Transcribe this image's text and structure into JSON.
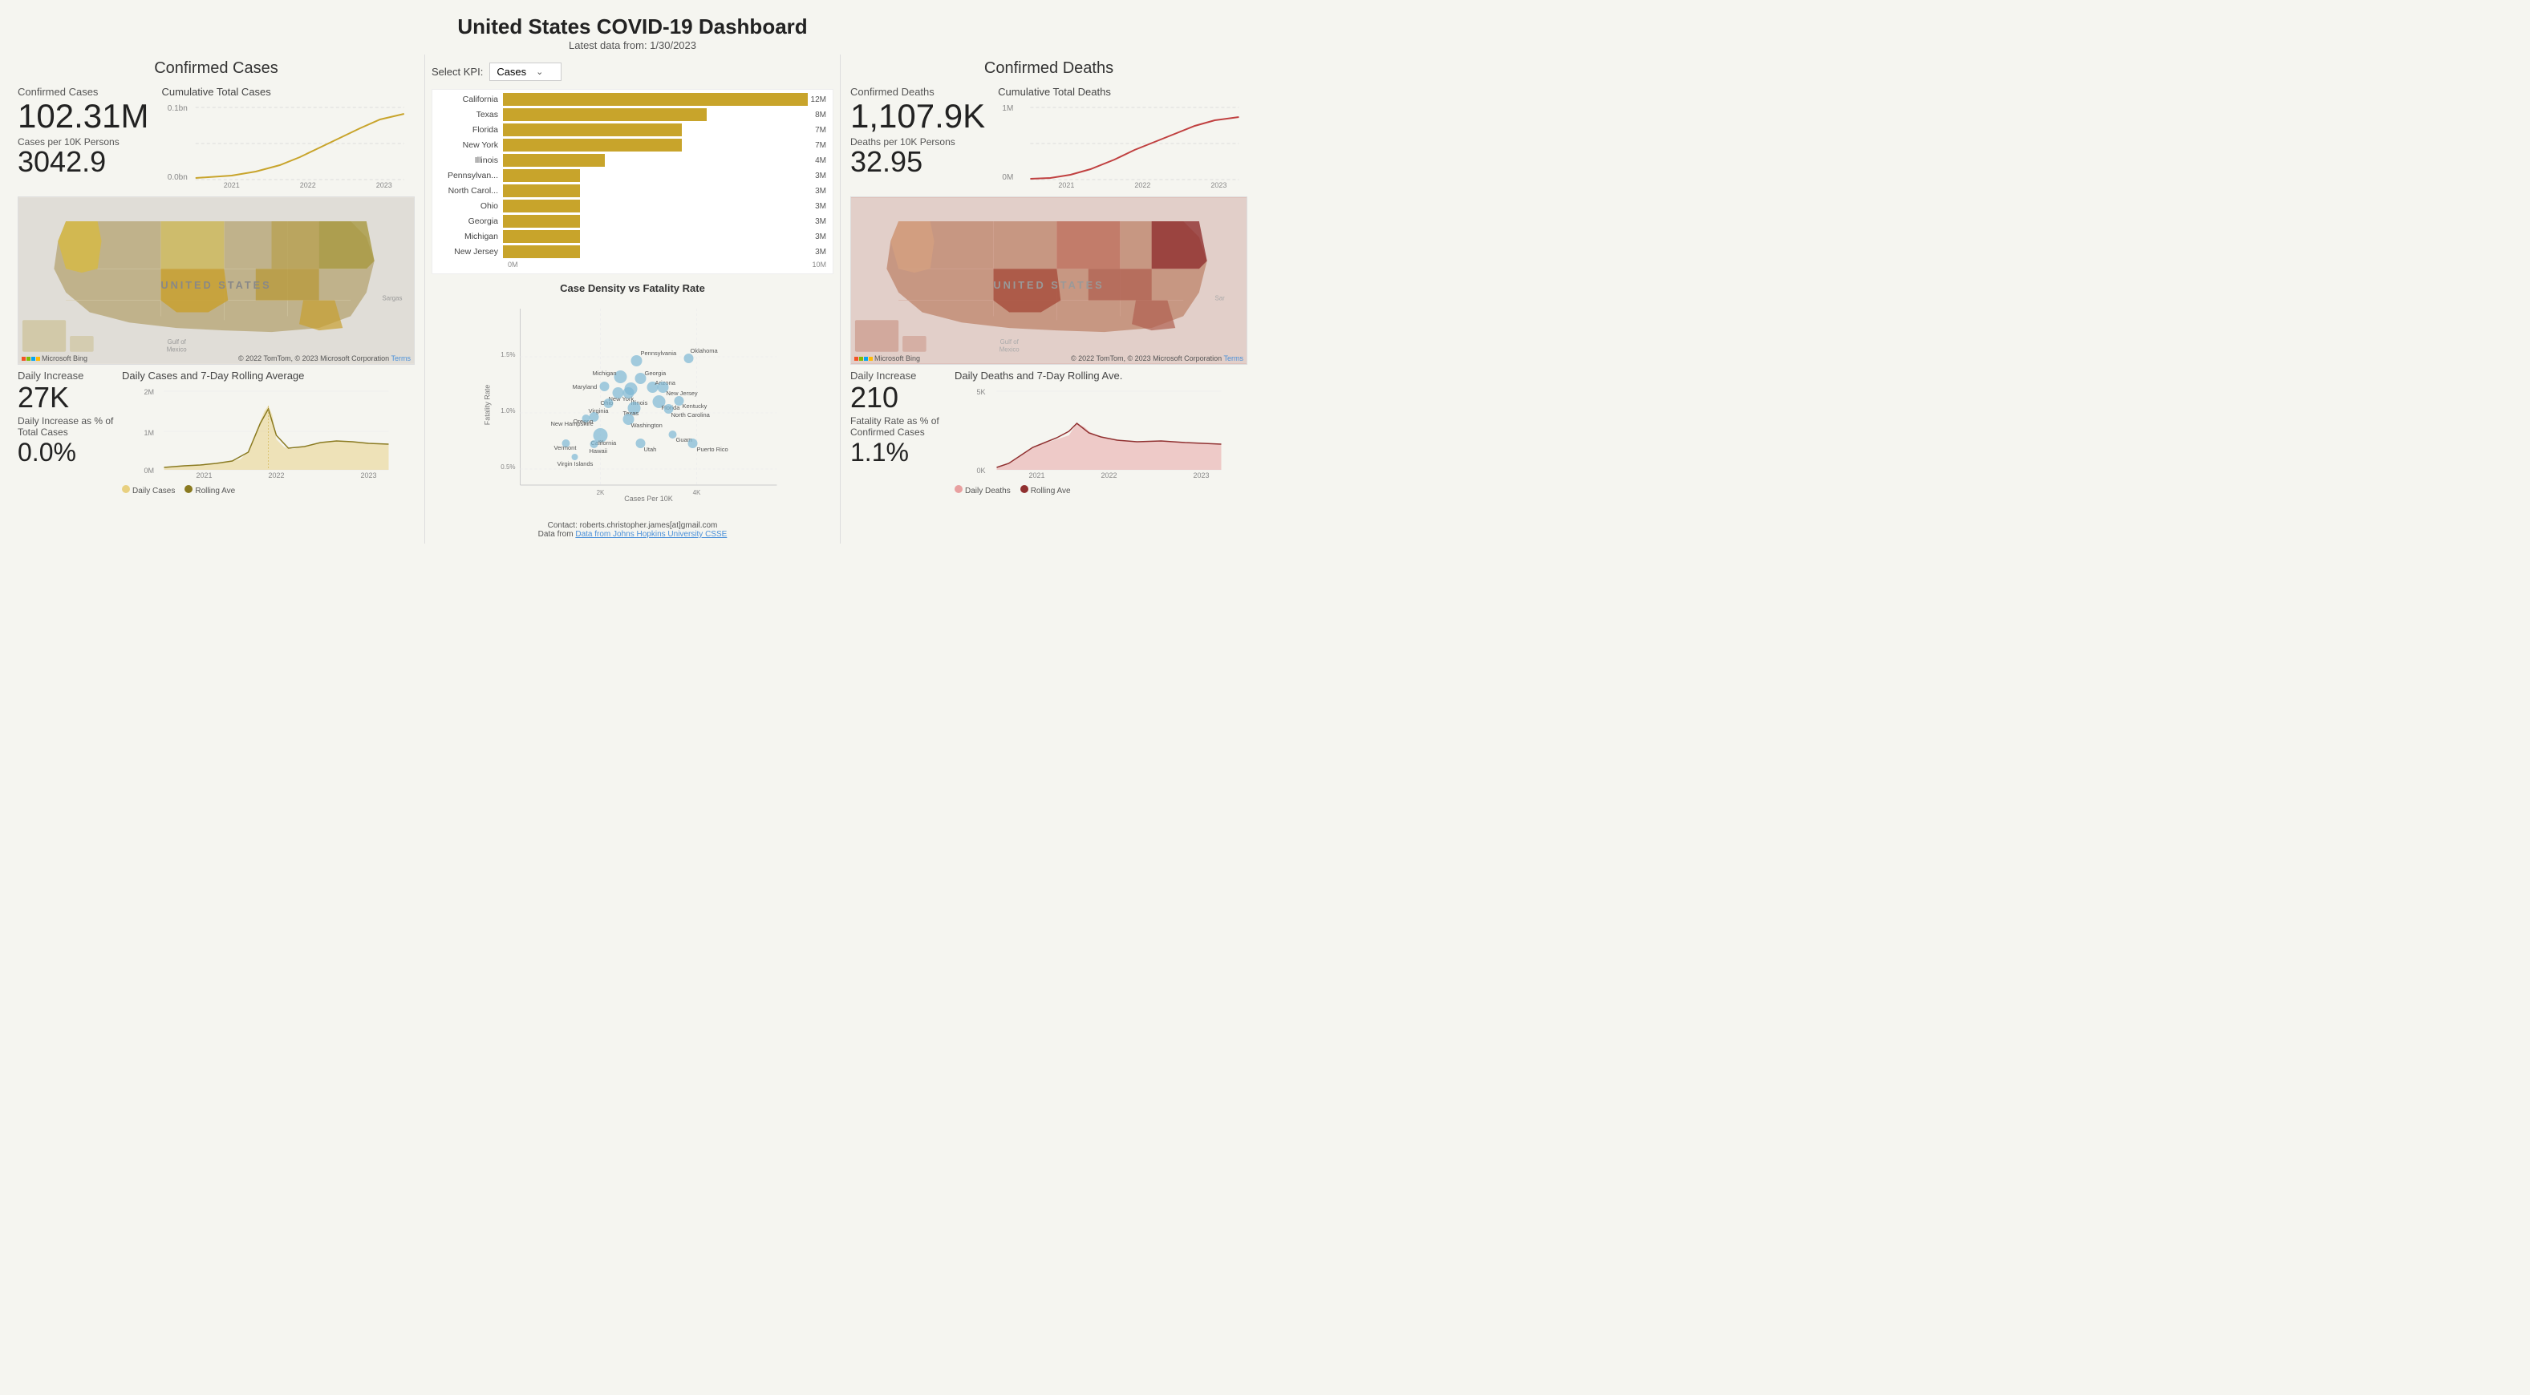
{
  "header": {
    "title": "United States COVID-19 Dashboard",
    "subtitle": "Latest data from: 1/30/2023"
  },
  "left": {
    "panel_title": "Confirmed Cases",
    "confirmed_cases_label": "Confirmed Cases",
    "confirmed_cases_value": "102.31M",
    "cumulative_chart_title": "Cumulative Total Cases",
    "cumulative_y_top": "0.1bn",
    "cumulative_y_bot": "0.0bn",
    "cases_per_10k_label": "Cases per 10K Persons",
    "cases_per_10k_value": "3042.9",
    "map_label": "UNITED STATES",
    "map_attribution": "© 2022 TomTom, © 2023 Microsoft Corporation",
    "map_terms": "Terms",
    "map_bing": "Microsoft Bing",
    "daily_increase_label": "Daily Increase",
    "daily_increase_value": "27K",
    "daily_chart_title": "Daily Cases and 7-Day Rolling Average",
    "daily_y_top": "2M",
    "daily_y_mid": "1M",
    "daily_y_bot": "0M",
    "daily_pct_label": "Daily Increase as % of Total Cases",
    "daily_pct_value": "0.0%",
    "legend_cases": "Daily Cases",
    "legend_rolling": "Rolling Ave",
    "x_labels": [
      "2021",
      "2022",
      "2023"
    ],
    "x_labels_daily": [
      "2021",
      "2022",
      "2023"
    ]
  },
  "center": {
    "kpi_select_label": "Select KPI:",
    "kpi_select_value": "Cases",
    "bar_chart_title": "",
    "bars": [
      {
        "label": "California",
        "value": "12M",
        "pct": 100
      },
      {
        "label": "Texas",
        "value": "8M",
        "pct": 66
      },
      {
        "label": "Florida",
        "value": "7M",
        "pct": 58
      },
      {
        "label": "New York",
        "value": "7M",
        "pct": 58
      },
      {
        "label": "Illinois",
        "value": "4M",
        "pct": 33
      },
      {
        "label": "Pennsylvan...",
        "value": "3M",
        "pct": 25
      },
      {
        "label": "North Carol...",
        "value": "3M",
        "pct": 25
      },
      {
        "label": "Ohio",
        "value": "3M",
        "pct": 25
      },
      {
        "label": "Georgia",
        "value": "3M",
        "pct": 25
      },
      {
        "label": "Michigan",
        "value": "3M",
        "pct": 25
      },
      {
        "label": "New Jersey",
        "value": "3M",
        "pct": 25
      }
    ],
    "bar_x_labels": [
      "0M",
      "10M"
    ],
    "scatter_title": "Case Density vs Fatality Rate",
    "scatter_x_label": "Cases Per 10K",
    "scatter_y_label": "Fatality Rate",
    "scatter_x_ticks": [
      "2K",
      "4K"
    ],
    "scatter_y_ticks": [
      "0.5%",
      "1.0%",
      "1.5%"
    ],
    "scatter_points": [
      {
        "label": "Pennsylvania",
        "x": 55,
        "y": 15,
        "r": 8
      },
      {
        "label": "Oklahoma",
        "x": 75,
        "y": 17,
        "r": 7
      },
      {
        "label": "Michigan",
        "x": 48,
        "y": 28,
        "r": 9
      },
      {
        "label": "Georgia",
        "x": 55,
        "y": 26,
        "r": 8
      },
      {
        "label": "Maryland",
        "x": 42,
        "y": 32,
        "r": 7
      },
      {
        "label": "New York",
        "x": 52,
        "y": 32,
        "r": 9
      },
      {
        "label": "Arizona",
        "x": 60,
        "y": 30,
        "r": 8
      },
      {
        "label": "New Jersey",
        "x": 63,
        "y": 30,
        "r": 8
      },
      {
        "label": "Ohio",
        "x": 47,
        "y": 33,
        "r": 8
      },
      {
        "label": "Illinois",
        "x": 51,
        "y": 33,
        "r": 8
      },
      {
        "label": "Virginia",
        "x": 43,
        "y": 38,
        "r": 7
      },
      {
        "label": "Florida",
        "x": 62,
        "y": 37,
        "r": 9
      },
      {
        "label": "Kentucky",
        "x": 69,
        "y": 36,
        "r": 7
      },
      {
        "label": "Texas",
        "x": 52,
        "y": 38,
        "r": 9
      },
      {
        "label": "North Carolina",
        "x": 64,
        "y": 40,
        "r": 7
      },
      {
        "label": "Oregon",
        "x": 38,
        "y": 43,
        "r": 7
      },
      {
        "label": "Washington",
        "x": 50,
        "y": 43,
        "r": 8
      },
      {
        "label": "New Hampshire",
        "x": 36,
        "y": 43,
        "r": 6
      },
      {
        "label": "California",
        "x": 40,
        "y": 52,
        "r": 10
      },
      {
        "label": "Guam",
        "x": 65,
        "y": 52,
        "r": 6
      },
      {
        "label": "Vermont",
        "x": 28,
        "y": 57,
        "r": 6
      },
      {
        "label": "Hawaii",
        "x": 38,
        "y": 57,
        "r": 6
      },
      {
        "label": "Utah",
        "x": 55,
        "y": 57,
        "r": 7
      },
      {
        "label": "Puerto Rico",
        "x": 72,
        "y": 57,
        "r": 7
      },
      {
        "label": "Virgin Islands",
        "x": 32,
        "y": 65,
        "r": 5
      }
    ],
    "contact": "Contact: roberts.christopher.james[at]gmail.com",
    "data_source": "Data from Johns Hopkins University CSSE",
    "data_source_url": "#"
  },
  "right": {
    "panel_title": "Confirmed Deaths",
    "confirmed_deaths_label": "Confirmed Deaths",
    "confirmed_deaths_value": "1,107.9K",
    "cumulative_chart_title": "Cumulative Total Deaths",
    "cumulative_y_top": "1M",
    "cumulative_y_bot": "0M",
    "deaths_per_10k_label": "Deaths per 10K Persons",
    "deaths_per_10k_value": "32.95",
    "map_label": "UNITED STATES",
    "map_attribution": "© 2022 TomTom, © 2023 Microsoft Corporation",
    "map_terms": "Terms",
    "map_bing": "Microsoft Bing",
    "daily_increase_label": "Daily Increase",
    "daily_increase_value": "210",
    "daily_chart_title": "Daily Deaths and 7-Day Rolling Ave.",
    "daily_y_top": "5K",
    "daily_y_bot": "0K",
    "fatality_rate_label": "Fatality Rate as % of Confirmed Cases",
    "fatality_rate_value": "1.1%",
    "legend_deaths": "Daily Deaths",
    "legend_rolling": "Rolling Ave",
    "x_labels": [
      "2021",
      "2022",
      "2023"
    ]
  }
}
